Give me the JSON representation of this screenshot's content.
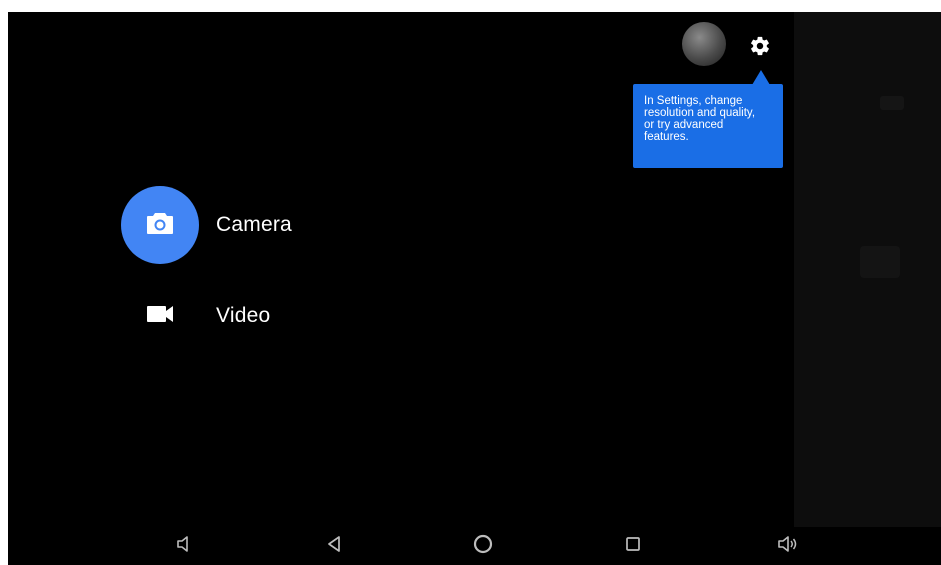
{
  "modes": {
    "camera": {
      "label": "Camera",
      "icon": "camera-icon",
      "selected": true
    },
    "video": {
      "label": "Video",
      "icon": "videocam-icon",
      "selected": false
    }
  },
  "tooltip": {
    "text_lines": [
      "In Settings, change",
      "resolution and quality,",
      "or try advanced",
      "features."
    ]
  },
  "top_controls": {
    "thumbnail": "gallery-thumbnail",
    "settings_icon": "gear-icon"
  },
  "nav_bar": {
    "buttons": [
      "volume-down-icon",
      "back-icon",
      "home-icon",
      "recents-icon",
      "volume-up-icon"
    ]
  },
  "colors": {
    "accent": "#4285f4",
    "tooltip_bg": "#1a6ee6",
    "background": "#000000"
  }
}
